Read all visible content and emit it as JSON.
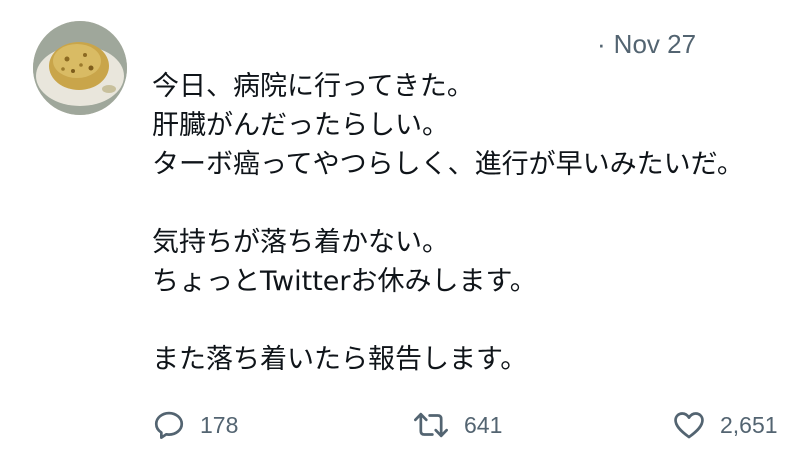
{
  "tweet": {
    "date": "Nov 27",
    "date_separator": "·",
    "lines": [
      "今日、病院に行ってきた。",
      "肝臓がんだったらしい。",
      "ターボ癌ってやつらしく、進行が早いみたいだ。",
      "",
      "気持ちが落ち着かない。",
      "ちょっとTwitterお休みします。",
      "",
      "また落ち着いたら報告します。"
    ]
  },
  "actions": {
    "reply_count": "178",
    "retweet_count": "641",
    "like_count": "2,651"
  },
  "icons": {
    "reply": "reply-icon",
    "retweet": "retweet-icon",
    "like": "like-icon"
  },
  "colors": {
    "text": "#0f1419",
    "secondary": "#536471"
  }
}
